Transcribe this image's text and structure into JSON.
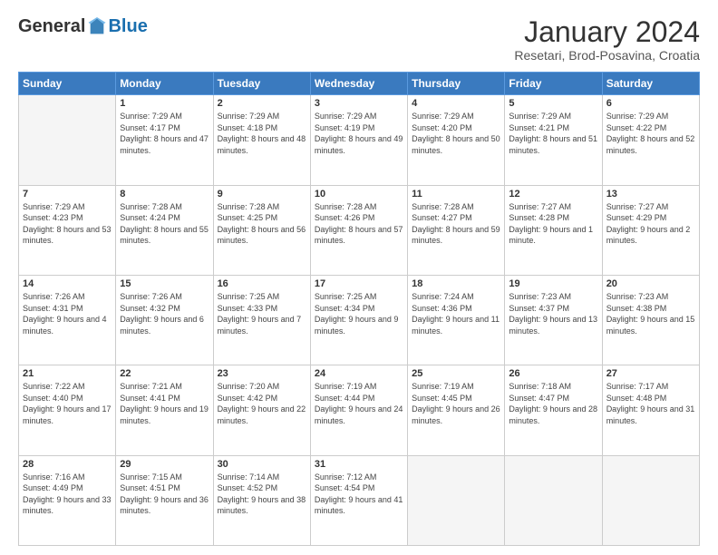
{
  "logo": {
    "general": "General",
    "blue": "Blue"
  },
  "header": {
    "month": "January 2024",
    "location": "Resetari, Brod-Posavina, Croatia"
  },
  "weekdays": [
    "Sunday",
    "Monday",
    "Tuesday",
    "Wednesday",
    "Thursday",
    "Friday",
    "Saturday"
  ],
  "weeks": [
    [
      {
        "day": "",
        "empty": true
      },
      {
        "day": "1",
        "sunrise": "Sunrise: 7:29 AM",
        "sunset": "Sunset: 4:17 PM",
        "daylight": "Daylight: 8 hours and 47 minutes."
      },
      {
        "day": "2",
        "sunrise": "Sunrise: 7:29 AM",
        "sunset": "Sunset: 4:18 PM",
        "daylight": "Daylight: 8 hours and 48 minutes."
      },
      {
        "day": "3",
        "sunrise": "Sunrise: 7:29 AM",
        "sunset": "Sunset: 4:19 PM",
        "daylight": "Daylight: 8 hours and 49 minutes."
      },
      {
        "day": "4",
        "sunrise": "Sunrise: 7:29 AM",
        "sunset": "Sunset: 4:20 PM",
        "daylight": "Daylight: 8 hours and 50 minutes."
      },
      {
        "day": "5",
        "sunrise": "Sunrise: 7:29 AM",
        "sunset": "Sunset: 4:21 PM",
        "daylight": "Daylight: 8 hours and 51 minutes."
      },
      {
        "day": "6",
        "sunrise": "Sunrise: 7:29 AM",
        "sunset": "Sunset: 4:22 PM",
        "daylight": "Daylight: 8 hours and 52 minutes."
      }
    ],
    [
      {
        "day": "7",
        "sunrise": "Sunrise: 7:29 AM",
        "sunset": "Sunset: 4:23 PM",
        "daylight": "Daylight: 8 hours and 53 minutes."
      },
      {
        "day": "8",
        "sunrise": "Sunrise: 7:28 AM",
        "sunset": "Sunset: 4:24 PM",
        "daylight": "Daylight: 8 hours and 55 minutes."
      },
      {
        "day": "9",
        "sunrise": "Sunrise: 7:28 AM",
        "sunset": "Sunset: 4:25 PM",
        "daylight": "Daylight: 8 hours and 56 minutes."
      },
      {
        "day": "10",
        "sunrise": "Sunrise: 7:28 AM",
        "sunset": "Sunset: 4:26 PM",
        "daylight": "Daylight: 8 hours and 57 minutes."
      },
      {
        "day": "11",
        "sunrise": "Sunrise: 7:28 AM",
        "sunset": "Sunset: 4:27 PM",
        "daylight": "Daylight: 8 hours and 59 minutes."
      },
      {
        "day": "12",
        "sunrise": "Sunrise: 7:27 AM",
        "sunset": "Sunset: 4:28 PM",
        "daylight": "Daylight: 9 hours and 1 minute."
      },
      {
        "day": "13",
        "sunrise": "Sunrise: 7:27 AM",
        "sunset": "Sunset: 4:29 PM",
        "daylight": "Daylight: 9 hours and 2 minutes."
      }
    ],
    [
      {
        "day": "14",
        "sunrise": "Sunrise: 7:26 AM",
        "sunset": "Sunset: 4:31 PM",
        "daylight": "Daylight: 9 hours and 4 minutes."
      },
      {
        "day": "15",
        "sunrise": "Sunrise: 7:26 AM",
        "sunset": "Sunset: 4:32 PM",
        "daylight": "Daylight: 9 hours and 6 minutes."
      },
      {
        "day": "16",
        "sunrise": "Sunrise: 7:25 AM",
        "sunset": "Sunset: 4:33 PM",
        "daylight": "Daylight: 9 hours and 7 minutes."
      },
      {
        "day": "17",
        "sunrise": "Sunrise: 7:25 AM",
        "sunset": "Sunset: 4:34 PM",
        "daylight": "Daylight: 9 hours and 9 minutes."
      },
      {
        "day": "18",
        "sunrise": "Sunrise: 7:24 AM",
        "sunset": "Sunset: 4:36 PM",
        "daylight": "Daylight: 9 hours and 11 minutes."
      },
      {
        "day": "19",
        "sunrise": "Sunrise: 7:23 AM",
        "sunset": "Sunset: 4:37 PM",
        "daylight": "Daylight: 9 hours and 13 minutes."
      },
      {
        "day": "20",
        "sunrise": "Sunrise: 7:23 AM",
        "sunset": "Sunset: 4:38 PM",
        "daylight": "Daylight: 9 hours and 15 minutes."
      }
    ],
    [
      {
        "day": "21",
        "sunrise": "Sunrise: 7:22 AM",
        "sunset": "Sunset: 4:40 PM",
        "daylight": "Daylight: 9 hours and 17 minutes."
      },
      {
        "day": "22",
        "sunrise": "Sunrise: 7:21 AM",
        "sunset": "Sunset: 4:41 PM",
        "daylight": "Daylight: 9 hours and 19 minutes."
      },
      {
        "day": "23",
        "sunrise": "Sunrise: 7:20 AM",
        "sunset": "Sunset: 4:42 PM",
        "daylight": "Daylight: 9 hours and 22 minutes."
      },
      {
        "day": "24",
        "sunrise": "Sunrise: 7:19 AM",
        "sunset": "Sunset: 4:44 PM",
        "daylight": "Daylight: 9 hours and 24 minutes."
      },
      {
        "day": "25",
        "sunrise": "Sunrise: 7:19 AM",
        "sunset": "Sunset: 4:45 PM",
        "daylight": "Daylight: 9 hours and 26 minutes."
      },
      {
        "day": "26",
        "sunrise": "Sunrise: 7:18 AM",
        "sunset": "Sunset: 4:47 PM",
        "daylight": "Daylight: 9 hours and 28 minutes."
      },
      {
        "day": "27",
        "sunrise": "Sunrise: 7:17 AM",
        "sunset": "Sunset: 4:48 PM",
        "daylight": "Daylight: 9 hours and 31 minutes."
      }
    ],
    [
      {
        "day": "28",
        "sunrise": "Sunrise: 7:16 AM",
        "sunset": "Sunset: 4:49 PM",
        "daylight": "Daylight: 9 hours and 33 minutes."
      },
      {
        "day": "29",
        "sunrise": "Sunrise: 7:15 AM",
        "sunset": "Sunset: 4:51 PM",
        "daylight": "Daylight: 9 hours and 36 minutes."
      },
      {
        "day": "30",
        "sunrise": "Sunrise: 7:14 AM",
        "sunset": "Sunset: 4:52 PM",
        "daylight": "Daylight: 9 hours and 38 minutes."
      },
      {
        "day": "31",
        "sunrise": "Sunrise: 7:12 AM",
        "sunset": "Sunset: 4:54 PM",
        "daylight": "Daylight: 9 hours and 41 minutes."
      },
      {
        "day": "",
        "empty": true
      },
      {
        "day": "",
        "empty": true
      },
      {
        "day": "",
        "empty": true
      }
    ]
  ]
}
